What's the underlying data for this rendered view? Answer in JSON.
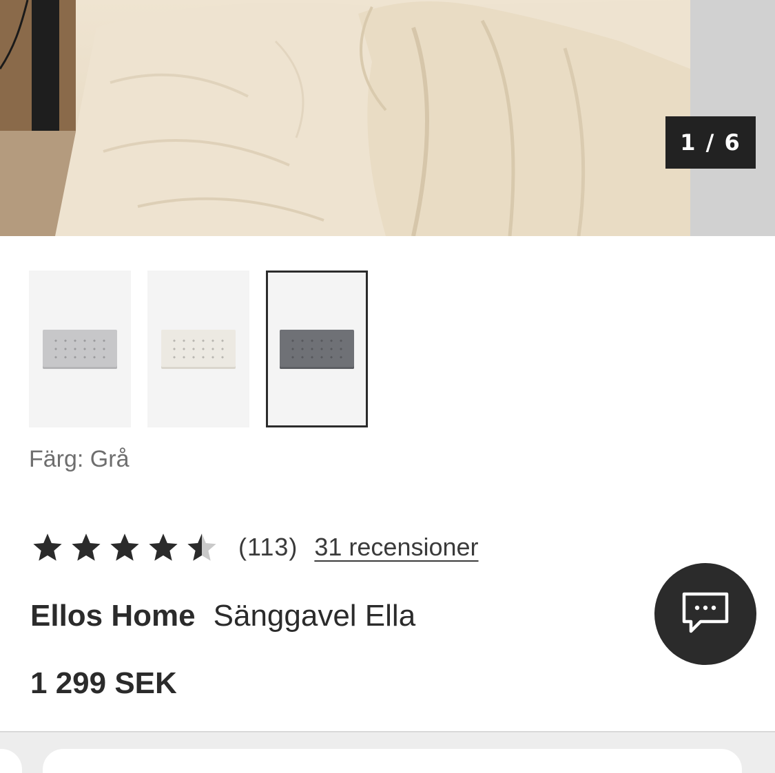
{
  "gallery": {
    "counter": "1 / 6"
  },
  "swatches": [
    {
      "name": "Ljusgrå",
      "color": "#c7c7c9",
      "selected": false
    },
    {
      "name": "Vit",
      "color": "#ece9e2",
      "selected": false
    },
    {
      "name": "Grå",
      "color": "#6f7176",
      "selected": true
    }
  ],
  "color_label": "Färg: Grå",
  "rating": {
    "stars": 4.5,
    "max_stars": 5,
    "count": "(113)",
    "reviews_link": "31 recensioner"
  },
  "product": {
    "brand": "Ellos Home",
    "name": "Sänggavel Ella",
    "price": "1 299 SEK"
  },
  "chat": {
    "icon": "chat-bubble-icon"
  },
  "colors": {
    "text": "#2b2b2b",
    "muted": "#6e6e6e",
    "counter_bg": "#222222",
    "star_empty": "#c9c9c9"
  }
}
